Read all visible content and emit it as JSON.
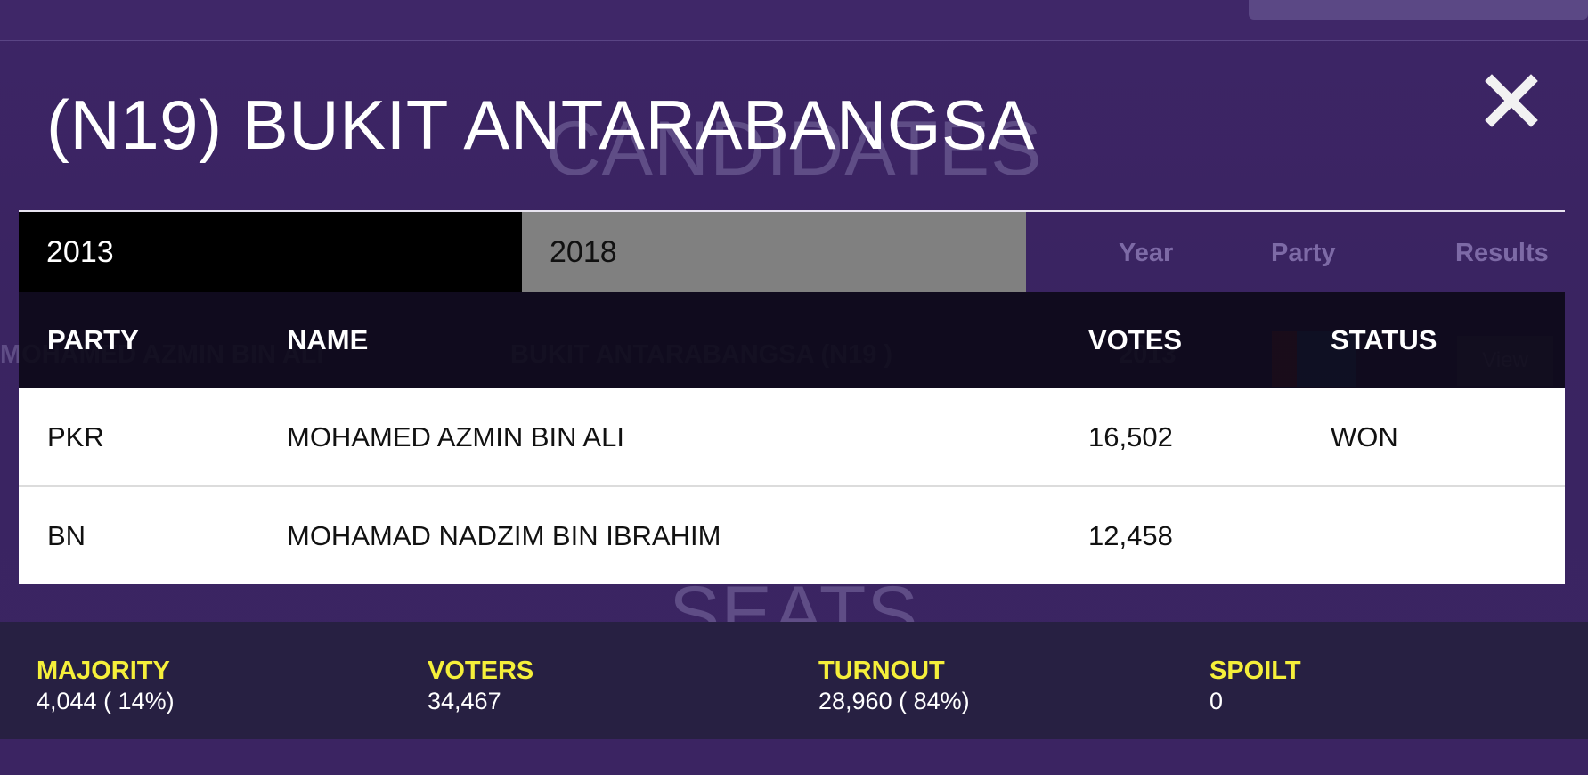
{
  "background": {
    "section_heading": "CANDIDATES",
    "seats_heading": "SEATS",
    "columns": [
      "Year",
      "Party",
      "Results"
    ],
    "rows": [
      {
        "name": "MOHAMED AZMIN BIN ALI",
        "seat": "BUKIT ANTARABANGSA (N19 )",
        "year": "2013",
        "action": "View"
      }
    ]
  },
  "modal": {
    "title": "(N19) BUKIT ANTARABANGSA",
    "close_icon": "close-x-icon",
    "tabs": [
      {
        "label": "2013",
        "active": true
      },
      {
        "label": "2018",
        "active": false
      }
    ],
    "table": {
      "headers": {
        "party": "PARTY",
        "name": "NAME",
        "votes": "VOTES",
        "status": "STATUS"
      },
      "rows": [
        {
          "party": "PKR",
          "name": "MOHAMED AZMIN BIN ALI",
          "votes": "16,502",
          "status": "WON"
        },
        {
          "party": "BN",
          "name": "MOHAMAD NADZIM BIN IBRAHIM",
          "votes": "12,458",
          "status": ""
        }
      ]
    },
    "stats": {
      "majority": {
        "label": "MAJORITY",
        "value": "4,044 ( 14%)"
      },
      "voters": {
        "label": "VOTERS",
        "value": "34,467"
      },
      "turnout": {
        "label": "TURNOUT",
        "value": "28,960 ( 84%)"
      },
      "spoilt": {
        "label": "SPOILT",
        "value": "0"
      }
    }
  },
  "colors": {
    "background_purple": "#3a2461",
    "active_tab": "#000000",
    "inactive_tab": "#808080",
    "table_header": "#0a0814",
    "stats_bar": "#272042",
    "stat_label": "#f5ef3a"
  }
}
